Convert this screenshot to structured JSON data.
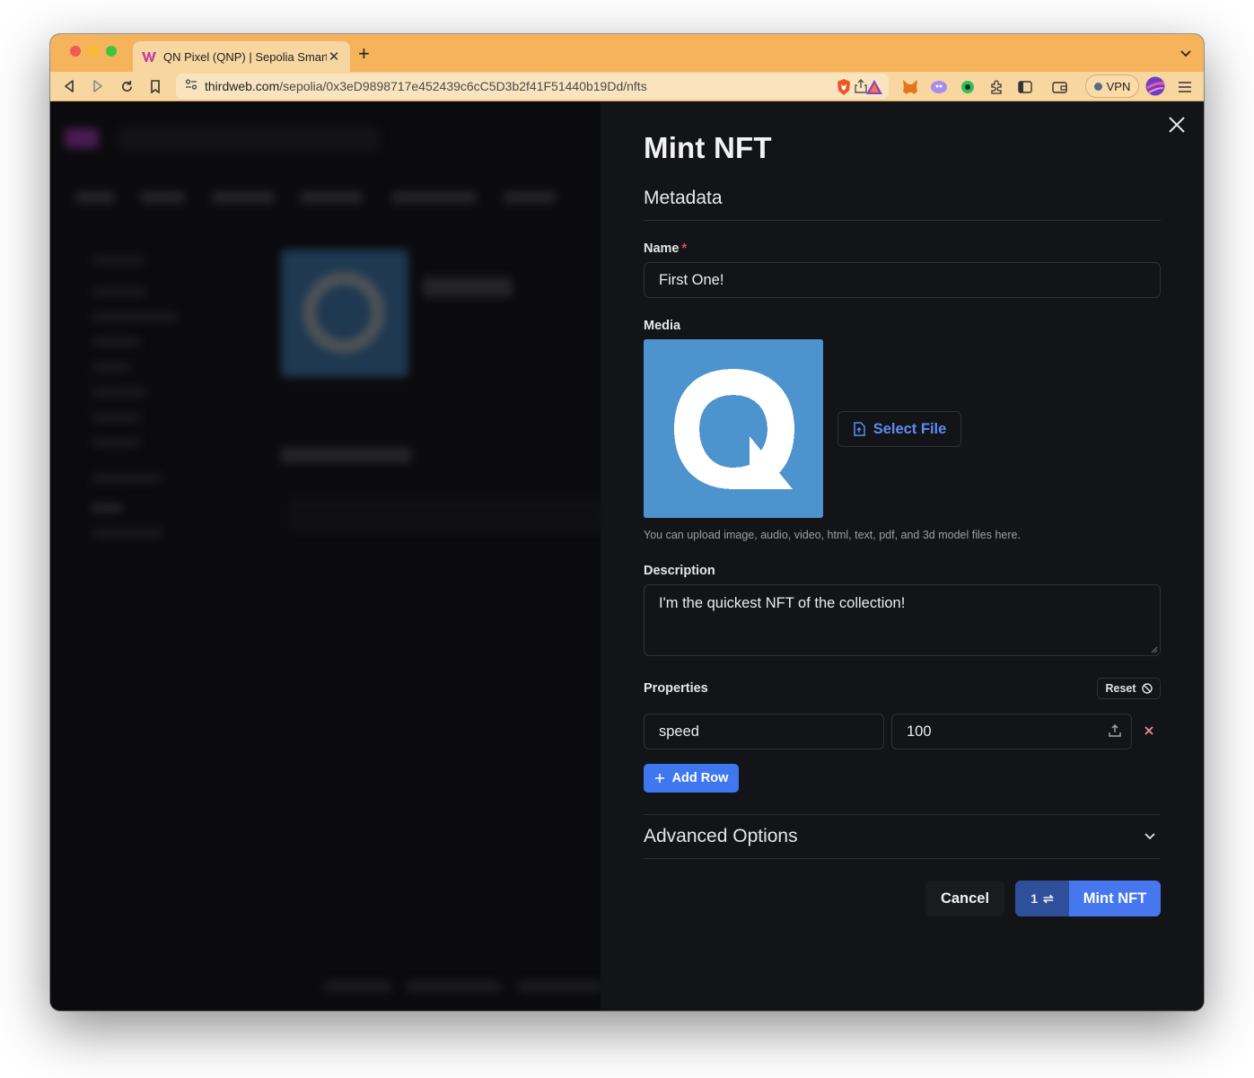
{
  "browser": {
    "tab_title": "QN Pixel (QNP) | Sepolia Smart",
    "url_host": "thirdweb.com",
    "url_path": "/sepolia/0x3eD9898717e452439c6cC5D3b2f41F51440b19Dd/nfts",
    "vpn_label": "VPN"
  },
  "drawer": {
    "title": "Mint NFT",
    "section_title": "Metadata",
    "name_label": "Name",
    "name_required_mark": "*",
    "name_value": "First One!",
    "media_label": "Media",
    "select_file_label": "Select File",
    "media_hint": "You can upload image, audio, video, html, text, pdf, and 3d model files here.",
    "description_label": "Description",
    "description_value": "I'm the quickest NFT of the collection!",
    "properties_label": "Properties",
    "reset_label": "Reset",
    "properties": [
      {
        "key": "speed",
        "value": "100"
      }
    ],
    "add_row_label": "Add Row",
    "advanced_label": "Advanced Options",
    "cancel_label": "Cancel",
    "mint_count": "1",
    "mint_label": "Mint NFT"
  },
  "colors": {
    "accent": "#4677ee",
    "browser_chrome": "#f5b35c",
    "panel_bg": "#131418",
    "media_bg": "#4d94cf",
    "required": "#e5484d"
  },
  "icons": [
    "back-icon",
    "forward-icon",
    "reload-icon",
    "bookmark-icon",
    "site-settings-icon",
    "share-icon",
    "brave-shield-icon",
    "brave-rewards-icon",
    "metamask-icon",
    "extension-icon",
    "puzzle-icon",
    "sidebar-icon",
    "wallet-icon",
    "profile-icon",
    "menu-icon",
    "close-icon",
    "file-icon",
    "reset-icon",
    "upload-icon",
    "remove-icon",
    "plus-icon",
    "chevron-down-icon",
    "swap-icon"
  ]
}
